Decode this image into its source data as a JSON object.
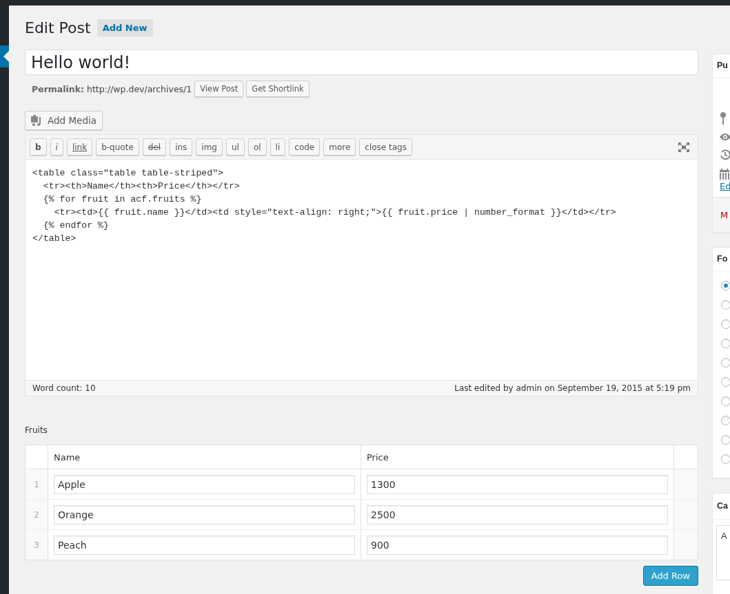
{
  "admin_menu": {
    "items": [
      {
        "selected": true
      }
    ]
  },
  "heading": "Edit Post",
  "add_new": "Add New",
  "title_field": {
    "value": "Hello world!"
  },
  "permalink": {
    "label": "Permalink:",
    "url": "http://wp.dev/archives/1",
    "buttons": [
      "View Post",
      "Get Shortlink"
    ]
  },
  "add_media": "Add Media",
  "quicktags": [
    {
      "label": "b",
      "kind": "bold"
    },
    {
      "label": "i",
      "kind": "italic"
    },
    {
      "label": "link",
      "kind": "underline"
    },
    {
      "label": "b-quote",
      "kind": "plain"
    },
    {
      "label": "del",
      "kind": "strike"
    },
    {
      "label": "ins",
      "kind": "plain"
    },
    {
      "label": "img",
      "kind": "plain"
    },
    {
      "label": "ul",
      "kind": "plain"
    },
    {
      "label": "ol",
      "kind": "plain"
    },
    {
      "label": "li",
      "kind": "plain"
    },
    {
      "label": "code",
      "kind": "plain"
    },
    {
      "label": "more",
      "kind": "plain"
    },
    {
      "label": "close tags",
      "kind": "plain"
    }
  ],
  "editor": {
    "content": "<table class=\"table table-striped\">\n  <tr><th>Name</th><th>Price</th></tr>\n  {% for fruit in acf.fruits %}\n    <tr><td>{{ fruit.name }}</td><td style=\"text-align: right;\">{{ fruit.price | number_format }}</td></tr>\n  {% endfor %}\n</table>",
    "word_count": "Word count: 10",
    "last_edited": "Last edited by admin on September 19, 2015 at 5:19 pm"
  },
  "fruits": {
    "label": "Fruits",
    "columns": [
      "Name",
      "Price"
    ],
    "rows": [
      {
        "index": "1",
        "name": "Apple",
        "price": "1300"
      },
      {
        "index": "2",
        "name": "Orange",
        "price": "2500"
      },
      {
        "index": "3",
        "name": "Peach",
        "price": "900"
      }
    ],
    "add_row": "Add Row"
  },
  "sidebar": {
    "publish": {
      "title": "Pu",
      "edit_link": "Ed",
      "trash_link": "M"
    },
    "format": {
      "title": "Fo",
      "options": [
        {
          "selected": true
        },
        {
          "selected": false
        },
        {
          "selected": false
        },
        {
          "selected": false
        },
        {
          "selected": false
        },
        {
          "selected": false
        },
        {
          "selected": false
        },
        {
          "selected": false
        },
        {
          "selected": false
        },
        {
          "selected": false
        }
      ]
    },
    "categories": {
      "title": "Ca",
      "item": "A"
    }
  }
}
